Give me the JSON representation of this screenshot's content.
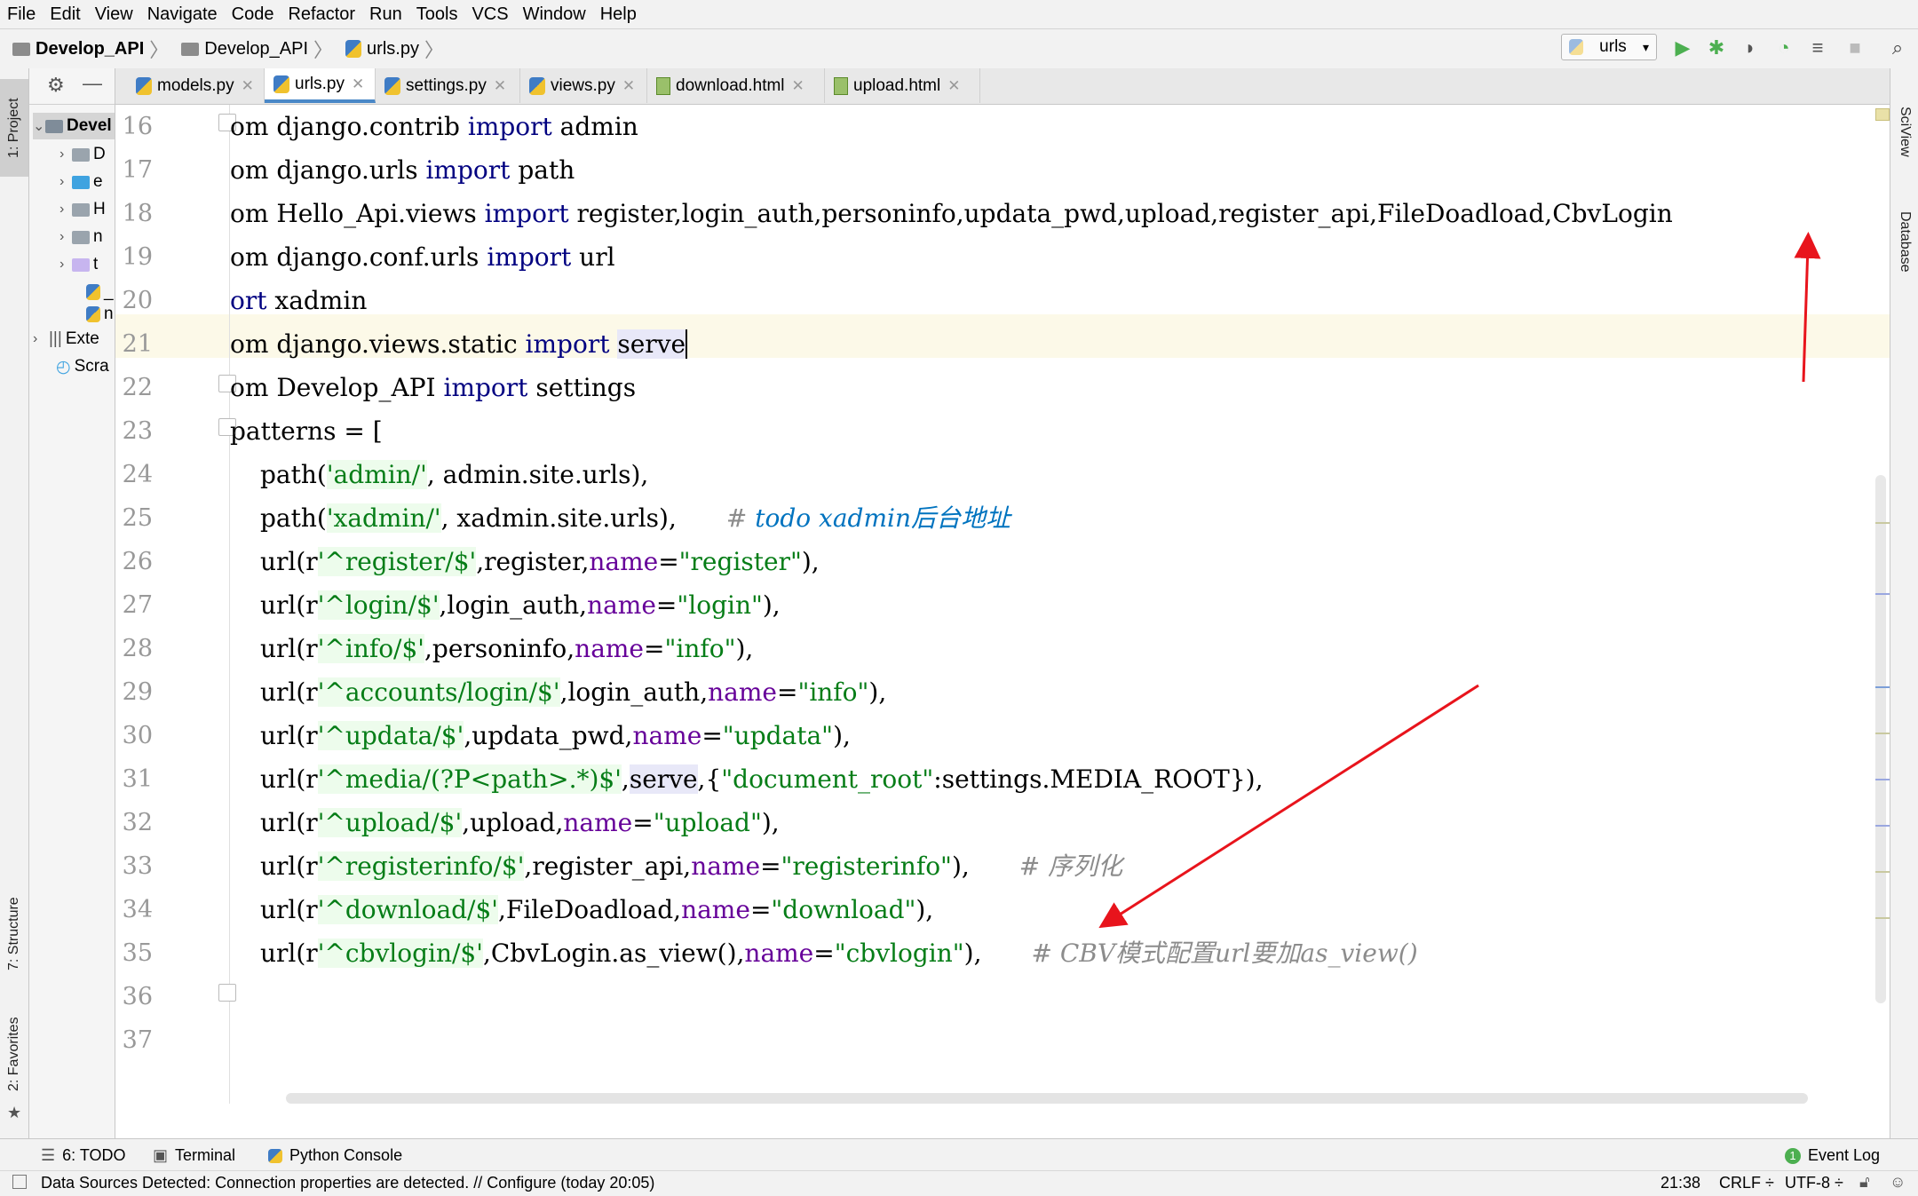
{
  "menu": [
    "File",
    "Edit",
    "View",
    "Navigate",
    "Code",
    "Refactor",
    "Run",
    "Tools",
    "VCS",
    "Window",
    "Help"
  ],
  "breadcrumb": {
    "project": "Develop_API",
    "folder": "Develop_API",
    "file": "urls.py"
  },
  "run_config": "urls",
  "left_strip": {
    "project": "1: Project",
    "structure": "7: Structure",
    "favorites": "2: Favorites"
  },
  "right_strip": {
    "sciview": "SciView",
    "database": "Database"
  },
  "project_tree": {
    "root": "Devel",
    "items": [
      "D",
      "e",
      "H",
      "n",
      "t",
      "_",
      "n"
    ],
    "external": "Exte",
    "scratches": "Scra"
  },
  "tabs": [
    "models.py",
    "urls.py",
    "settings.py",
    "views.py",
    "download.html",
    "upload.html"
  ],
  "line_numbers": [
    "16",
    "17",
    "18",
    "19",
    "20",
    "21",
    "22",
    "23",
    "24",
    "25",
    "26",
    "27",
    "28",
    "29",
    "30",
    "31",
    "32",
    "33",
    "34",
    "35",
    "36",
    "37"
  ],
  "code": {
    "l16": {
      "a": "om",
      "b": " django.contrib ",
      "kw": "import",
      "c": " admin"
    },
    "l17": {
      "a": "om",
      "b": " django.urls ",
      "kw": "import",
      "c": " path"
    },
    "l18": {
      "a": "om",
      "b": " Hello_Api.views ",
      "kw": "import",
      "c": " register,login_auth,personinfo,updata_pwd,upload,register_api,FileDoadload,CbvLogin"
    },
    "l19": {
      "a": "om",
      "b": " django.conf.urls ",
      "kw": "import",
      "c": " url"
    },
    "l20": {
      "a": "ort",
      "b": " xadmin"
    },
    "l21": {
      "a": "om",
      "b": " django.views.static ",
      "kw": "import",
      "c": " ",
      "hl": "serve"
    },
    "l22": {
      "a": "om",
      "b": " Develop_API ",
      "kw": "import",
      "c": " settings"
    },
    "l23": {
      "a": "patterns = ["
    },
    "l24": {
      "a": "path(",
      "s": "'admin/'",
      "b": ", admin.site.urls),"
    },
    "l25": {
      "a": "path(",
      "s": "'xadmin/'",
      "b": ", xadmin.site.urls),",
      "cm": "# ",
      "todo": "todo xadmin后台地址"
    },
    "l26": {
      "a": "url(r",
      "s": "'^register/$'",
      "b": ",register,",
      "p": "name",
      "e": "=",
      "v": "\"register\"",
      "z": "),"
    },
    "l27": {
      "a": "url(r",
      "s": "'^login/$'",
      "b": ",login_auth,",
      "p": "name",
      "e": "=",
      "v": "\"login\"",
      "z": "),"
    },
    "l28": {
      "a": "url(r",
      "s": "'^info/$'",
      "b": ",personinfo,",
      "p": "name",
      "e": "=",
      "v": "\"info\"",
      "z": "),"
    },
    "l29": {
      "a": "url(r",
      "s": "'^accounts/login/$'",
      "b": ",login_auth,",
      "p": "name",
      "e": "=",
      "v": "\"info\"",
      "z": "),"
    },
    "l30": {
      "a": "url(r",
      "s": "'^updata/$'",
      "b": ",updata_pwd,",
      "p": "name",
      "e": "=",
      "v": "\"updata\"",
      "z": "),"
    },
    "l31": {
      "a": "url(r",
      "s": "'^media/(?P<path>.*)$'",
      "b": ",",
      "hl": "serve",
      "c": ",{",
      "v": "\"document_root\"",
      "z": ":settings.MEDIA_ROOT}),"
    },
    "l32": {
      "a": "url(r",
      "s": "'^upload/$'",
      "b": ",upload,",
      "p": "name",
      "e": "=",
      "v": "\"upload\"",
      "z": "),"
    },
    "l33": {
      "a": "url(r",
      "s": "'^registerinfo/$'",
      "b": ",register_api,",
      "p": "name",
      "e": "=",
      "v": "\"registerinfo\"",
      "z": "),",
      "cm": "# 序列化"
    },
    "l34": {
      "a": "url(r",
      "s": "'^download/$'",
      "b": ",FileDoadload,",
      "p": "name",
      "e": "=",
      "v": "\"download\"",
      "z": "),"
    },
    "l35": {
      "a": "url(r",
      "s": "'^cbvlogin/$'",
      "b": ",CbvLogin.as_view(),",
      "p": "name",
      "e": "=",
      "v": "\"cbvlogin\"",
      "z": "),",
      "cm": "# CBV模式配置url要加as_view()"
    }
  },
  "bottom_tools": {
    "todo": "6: TODO",
    "terminal": "Terminal",
    "python_console": "Python Console",
    "event_log": "Event Log",
    "event_count": "1"
  },
  "status": {
    "message": "Data Sources Detected: Connection properties are detected. // Configure (today 20:05)",
    "position": "21:38",
    "line_sep": "CRLF ÷",
    "encoding": "UTF-8 ÷"
  },
  "colors": {
    "annotation_arrow": "#e8141c",
    "keyword": "#000080",
    "string": "#067d17",
    "comment": "#8c8c8c"
  }
}
